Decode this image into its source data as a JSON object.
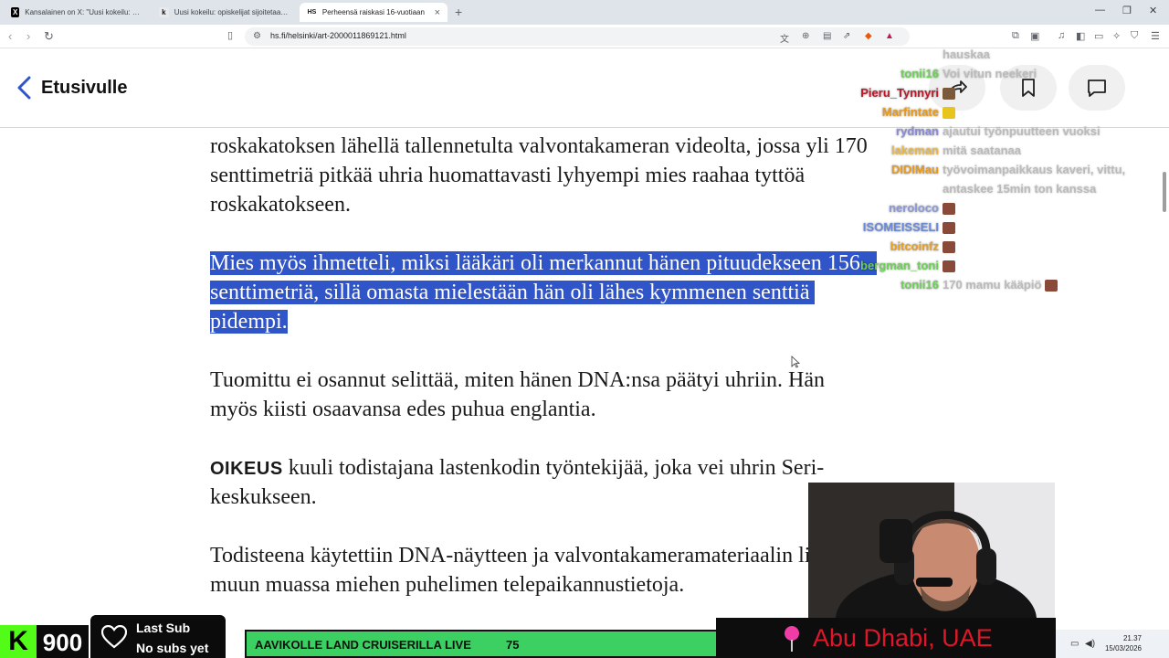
{
  "browser": {
    "tabs": [
      {
        "title": "Kansalainen on X: \"Uusi kokeilu: opiskelijat",
        "favicon": "X",
        "active": false
      },
      {
        "title": "Uusi kokeilu: opiskelijat sijoitetaan m",
        "favicon": "k",
        "active": false
      },
      {
        "title": "Perheensä raiskasi 16-vuotiaan",
        "favicon": "HS",
        "active": true
      }
    ],
    "url": "hs.fi/helsinki/art-2000011869121.html"
  },
  "site": {
    "back_label": "Etusivulle"
  },
  "article": {
    "para1": [
      "roskakatoksen lähellä tallennetulta valvontakameran videolta, jossa yli 170",
      "senttimetriä pitkää uhria huomattavasti lyhyempi mies raahaa tyttöä",
      "roskakatokseen."
    ],
    "para2_selected": [
      "Mies myös ihmetteli, miksi lääkäri oli merkannut hänen pituudekseen 156",
      "senttimetriä, sillä omasta mielestään hän oli lähes kymmenen senttiä",
      "pidempi."
    ],
    "para3": [
      "Tuomittu ei osannut selittää, miten hänen DNA:nsa päätyi uhriin. Hän",
      "myös kiisti osaavansa edes puhua englantia."
    ],
    "para4_kicker": "OIKEUS",
    "para4": [
      " kuuli todistajana lastenkodin työntekijää, joka vei uhrin Seri-",
      "keskukseen."
    ],
    "para5": [
      "Todisteena käytettiin DNA-näytteen ja valvontakameramateriaalin lisäksi",
      "muun muassa miehen puhelimen telepaikannustietoja."
    ]
  },
  "chat": [
    {
      "user": "",
      "msg": "hauskaa",
      "color": "#bdbdbd"
    },
    {
      "user": "tonii16",
      "msg": "Voi vitun neekeri",
      "color": "#6fcf5a"
    },
    {
      "user": "Pieru_Tynnyri",
      "msg": "",
      "color": "#c0182a",
      "emote": "#7a5a3a"
    },
    {
      "user": "Marfintate",
      "msg": "",
      "color": "#e89a1c",
      "emote": "#e8c51c"
    },
    {
      "user": "rydman",
      "msg": "ajautui työnpuutteen vuoksi",
      "color": "#8a8ad8"
    },
    {
      "user": "lakeman",
      "msg": "mitä saatanaa",
      "color": "#e8b84a"
    },
    {
      "user": "DIDIMau",
      "msg": "työvoimanpaikkaus kaveri, vittu,",
      "color": "#e89a1c"
    },
    {
      "user": "",
      "msg": "antaskee 15min ton kanssa",
      "color": "#bdbdbd"
    },
    {
      "user": "neroloco",
      "msg": "",
      "color": "#8a9ad8",
      "emote": "#8a4a3a"
    },
    {
      "user": "ISOMEISSELI",
      "msg": "",
      "color": "#6a8ad8",
      "emote": "#8a4a3a"
    },
    {
      "user": "bitcoinfz",
      "msg": "",
      "color": "#e8a01c",
      "emote": "#8a4a3a"
    },
    {
      "user": "bergman_toni",
      "msg": "",
      "color": "#6fcf5a",
      "emote": "#8a4a3a"
    },
    {
      "user": "tonii16",
      "msg": "170 mamu kääpiö",
      "color": "#6fcf5a",
      "emote": "#8a4a3a"
    }
  ],
  "stream": {
    "viewer_count": "900",
    "last_sub_title": "Last Sub",
    "last_sub_value": "No subs yet",
    "goal_label": "AAVIKOLLE LAND CRUISERILLA LIVE",
    "goal_current": "75",
    "goal_max": "75",
    "goal_fraction": 1.0,
    "location": "Abu Dhabi, UAE"
  },
  "tray": {
    "time": "21.37",
    "date": "15/03/2026"
  },
  "colors": {
    "selection": "#2f55c8",
    "kick_green": "#53fc18",
    "goal_green": "#3bd061",
    "location_red": "#e0162b"
  }
}
